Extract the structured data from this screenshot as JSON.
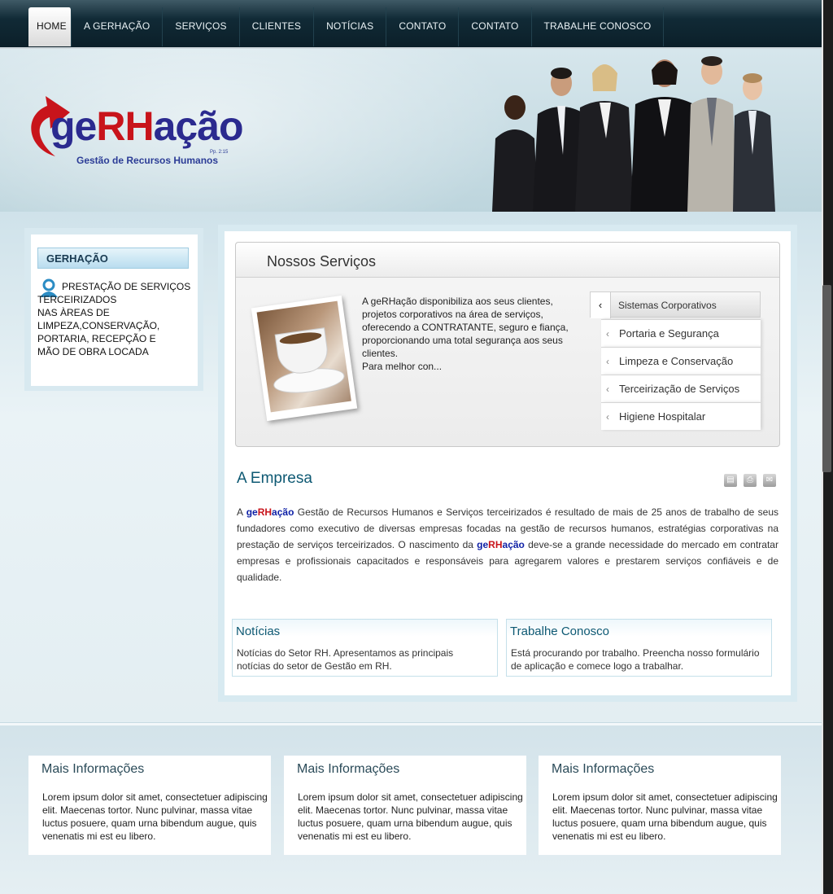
{
  "nav": {
    "items": [
      {
        "label": "HOME",
        "active": true
      },
      {
        "label": "A GERHAÇÃO"
      },
      {
        "label": "SERVIÇOS"
      },
      {
        "label": "CLIENTES"
      },
      {
        "label": "NOTÍCIAS"
      },
      {
        "label": "CONTATO"
      },
      {
        "label": "CONTATO"
      },
      {
        "label": "TRABALHE CONOSCO"
      }
    ]
  },
  "header": {
    "logo_pre": "ge",
    "logo_red": "RH",
    "logo_post": "ação",
    "logo_tagline": "Gestão de Recursos Humanos",
    "logo_ref": "Pp. 2:15"
  },
  "sidebar": {
    "title": "GERHAÇÃO",
    "text_line1": "PRESTAÇÃO DE SERVIÇOS",
    "text_rest": "TERCEIRIZADOS\nNAS ÀREAS  DE\nLIMPEZA,CONSERVAÇÃO,\nPORTARIA, RECEPÇÃO  E\nMÃO DE OBRA LOCADA"
  },
  "services": {
    "title": "Nossos Serviços",
    "description": "A geRHação disponibiliza aos seus clientes, projetos corporativos na área de serviços, oferecendo a CONTRATANTE, seguro e fiança, proporcionando uma total segurança aos seus clientes.\nPara melhor con...",
    "active_item": "Sistemas Corporativos",
    "items": [
      "Portaria e Segurança",
      "Limpeza e Conservação",
      "Terceirização de Serviços",
      "Higiene Hospitalar"
    ]
  },
  "article": {
    "title": "A Empresa",
    "brand_pre": "ge",
    "brand_red": "RH",
    "brand_post": "ação",
    "p1_before": "A ",
    "p1_after": " Gestão de Recursos Humanos e Serviços terceirizados é resultado de mais de 25 anos de trabalho de seus fundadores como executivo de diversas empresas focadas na gestão de recursos humanos, estratégias corporativas na prestação de serviços terceirizados. O nascimento da ",
    "p1_end": "  deve-se a grande necessidade do mercado em contratar empresas e profissionais capacitados e responsáveis para agregarem valores e prestarem serviços confiáveis e de qualidade."
  },
  "boxes": [
    {
      "title": "Notícias",
      "text": "Notícias do Setor RH. Apresentamos as principais notícias do setor de Gestão em RH."
    },
    {
      "title": "Trabalhe Conosco",
      "text": "Está procurando por trabalho. Preencha nosso formulário de aplicação e comece logo a trabalhar."
    }
  ],
  "footer": [
    {
      "title": "Mais Informações",
      "text": "Lorem ipsum dolor sit amet, consectetuer adipiscing elit. Maecenas tortor. Nunc pulvinar, massa vitae luctus posuere, quam urna bibendum augue, quis venenatis mi est eu libero."
    },
    {
      "title": "Mais Informações",
      "text": "Lorem ipsum dolor sit amet, consectetuer adipiscing elit. Maecenas tortor. Nunc pulvinar, massa vitae luctus posuere, quam urna bibendum augue, quis venenatis mi est eu libero."
    },
    {
      "title": "Mais Informações",
      "text": "Lorem ipsum dolor sit amet, consectetuer adipiscing elit. Maecenas tortor. Nunc pulvinar, massa vitae luctus posuere, quam urna bibendum augue, quis venenatis mi est eu libero."
    }
  ],
  "colors": {
    "nav_bg": "#0b1f29",
    "brand_blue": "#0d1fa6",
    "brand_red": "#c8141b",
    "title_teal": "#0e5973"
  }
}
